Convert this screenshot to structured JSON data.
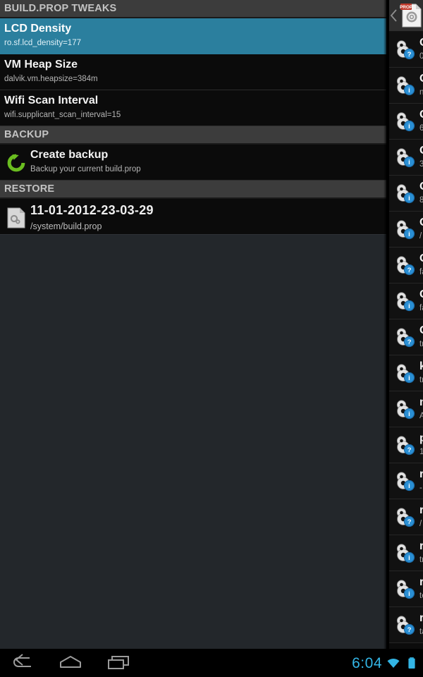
{
  "main": {
    "sections": [
      {
        "header": "BUILD.PROP TWEAKS",
        "rows": [
          {
            "title": "LCD Density",
            "subtitle": "ro.sf.lcd_density=177",
            "selected": true
          },
          {
            "title": "VM Heap Size",
            "subtitle": "dalvik.vm.heapsize=384m",
            "selected": false
          },
          {
            "title": "Wifi Scan Interval",
            "subtitle": "wifi.supplicant_scan_interval=15",
            "selected": false
          }
        ]
      },
      {
        "header": "BACKUP",
        "rows": [
          {
            "title": "Create backup",
            "subtitle": "Backup your current build.prop",
            "icon": "refresh-green-icon"
          }
        ]
      },
      {
        "header": "RESTORE",
        "rows": [
          {
            "title": "11-01-2012-23-03-29",
            "subtitle": "/system/build.prop",
            "icon": "prop-file-icon"
          }
        ]
      }
    ]
  },
  "drawer": {
    "back_label": "‹",
    "app_icon": "prop-app-icon",
    "app_icon_badge": "PROP",
    "rows": [
      {
        "title": "O",
        "subtitle": "0",
        "badge": "question"
      },
      {
        "title": "O",
        "subtitle": "n",
        "badge": "info"
      },
      {
        "title": "O",
        "subtitle": "6",
        "badge": "info"
      },
      {
        "title": "O",
        "subtitle": "3",
        "badge": "info"
      },
      {
        "title": "O",
        "subtitle": "8",
        "badge": "info"
      },
      {
        "title": "O",
        "subtitle": "/",
        "badge": "info"
      },
      {
        "title": "O",
        "subtitle": "fa",
        "badge": "question"
      },
      {
        "title": "O",
        "subtitle": "fa",
        "badge": "info"
      },
      {
        "title": "O",
        "subtitle": "tr",
        "badge": "question"
      },
      {
        "title": "k",
        "subtitle": "tr",
        "badge": "info"
      },
      {
        "title": "n",
        "subtitle": "A",
        "badge": "info"
      },
      {
        "title": "p",
        "subtitle": "1",
        "badge": "question"
      },
      {
        "title": "r",
        "subtitle": "-",
        "badge": "info"
      },
      {
        "title": "r",
        "subtitle": "/",
        "badge": "question"
      },
      {
        "title": "r",
        "subtitle": "tr",
        "badge": "info"
      },
      {
        "title": "r",
        "subtitle": "te",
        "badge": "info"
      },
      {
        "title": "r",
        "subtitle": "ta",
        "badge": "question"
      }
    ]
  },
  "navbar": {
    "back_icon": "back-arrow-icon",
    "home_icon": "home-icon",
    "recents_icon": "recents-icon",
    "clock": "6:04",
    "wifi_icon": "wifi-icon",
    "battery_icon": "battery-full-icon",
    "accent_color": "#33b5e5"
  },
  "colors": {
    "selected_row": "#2b7f9e",
    "section_header_bg": "#3c3c3c",
    "row_bg": "#0b0b0b",
    "accent": "#33b5e5",
    "backup_icon_green": "#6abd20"
  }
}
